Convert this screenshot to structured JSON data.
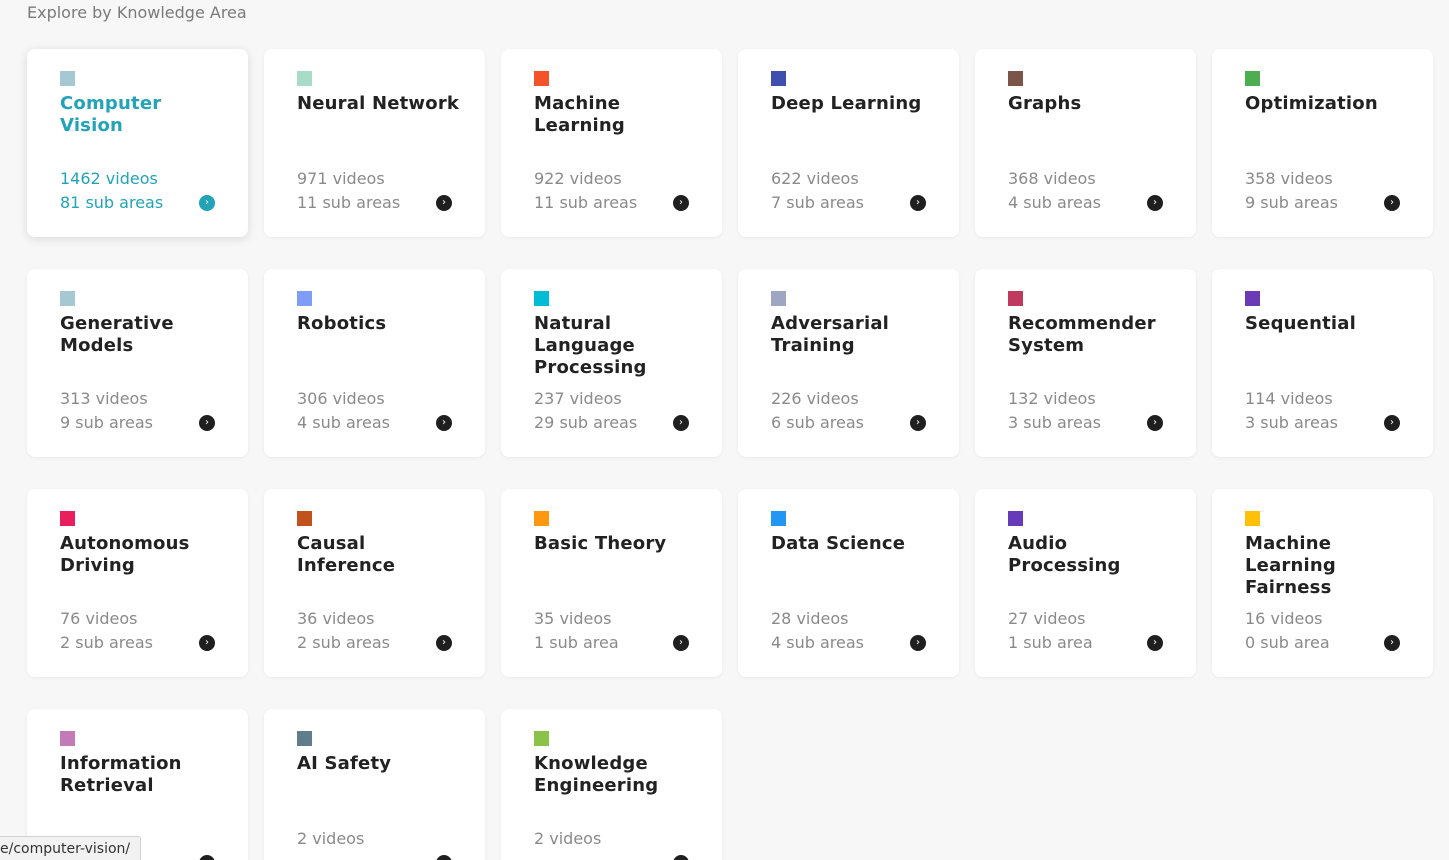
{
  "section": {
    "title": "Explore by Knowledge Area"
  },
  "cards": [
    {
      "title": "Computer Vision",
      "videos": "1462 videos",
      "subareas": "81 sub areas",
      "color": "#a6c8d2",
      "active": true
    },
    {
      "title": "Neural Network",
      "videos": "971 videos",
      "subareas": "11 sub areas",
      "color": "#a9dcc8"
    },
    {
      "title": "Machine Learning",
      "videos": "922 videos",
      "subareas": "11 sub areas",
      "color": "#f4532a"
    },
    {
      "title": "Deep Learning",
      "videos": "622 videos",
      "subareas": "7 sub areas",
      "color": "#3f4fae"
    },
    {
      "title": "Graphs",
      "videos": "368 videos",
      "subareas": "4 sub areas",
      "color": "#7a5548"
    },
    {
      "title": "Optimization",
      "videos": "358 videos",
      "subareas": "9 sub areas",
      "color": "#4cae50"
    },
    {
      "title": "Generative Models",
      "videos": "313 videos",
      "subareas": "9 sub areas",
      "color": "#a6c8d2"
    },
    {
      "title": "Robotics",
      "videos": "306 videos",
      "subareas": "4 sub areas",
      "color": "#7f9cf7"
    },
    {
      "title": "Natural Language Processing",
      "videos": "237 videos",
      "subareas": "29 sub areas",
      "color": "#00bcd4"
    },
    {
      "title": "Adversarial Training",
      "videos": "226 videos",
      "subareas": "6 sub areas",
      "color": "#9fa6c4"
    },
    {
      "title": "Recommender System",
      "videos": "132 videos",
      "subareas": "3 sub areas",
      "color": "#c0395e"
    },
    {
      "title": "Sequential",
      "videos": "114 videos",
      "subareas": "3 sub areas",
      "color": "#6a3ab7"
    },
    {
      "title": "Autonomous Driving",
      "videos": "76 videos",
      "subareas": "2 sub areas",
      "color": "#e91e5c"
    },
    {
      "title": "Causal Inference",
      "videos": "36 videos",
      "subareas": "2 sub areas",
      "color": "#c2521c"
    },
    {
      "title": "Basic Theory",
      "videos": "35 videos",
      "subareas": "1 sub area",
      "color": "#ff9810"
    },
    {
      "title": "Data Science",
      "videos": "28 videos",
      "subareas": "4 sub areas",
      "color": "#2196f3"
    },
    {
      "title": "Audio Processing",
      "videos": "27 videos",
      "subareas": "1 sub area",
      "color": "#673ab7"
    },
    {
      "title": "Machine Learning Fairness",
      "videos": "16 videos",
      "subareas": "0 sub area",
      "color": "#ffc107"
    },
    {
      "title": "Information Retrieval",
      "videos": "",
      "subareas": "",
      "color": "#c27bb6"
    },
    {
      "title": "AI Safety",
      "videos": "2 videos",
      "subareas": "",
      "color": "#607d8b"
    },
    {
      "title": "Knowledge Engineering",
      "videos": "2 videos",
      "subareas": "",
      "color": "#8bc34a"
    }
  ],
  "arrow_glyph": "›",
  "status_bar": {
    "url": "e/computer-vision/"
  }
}
